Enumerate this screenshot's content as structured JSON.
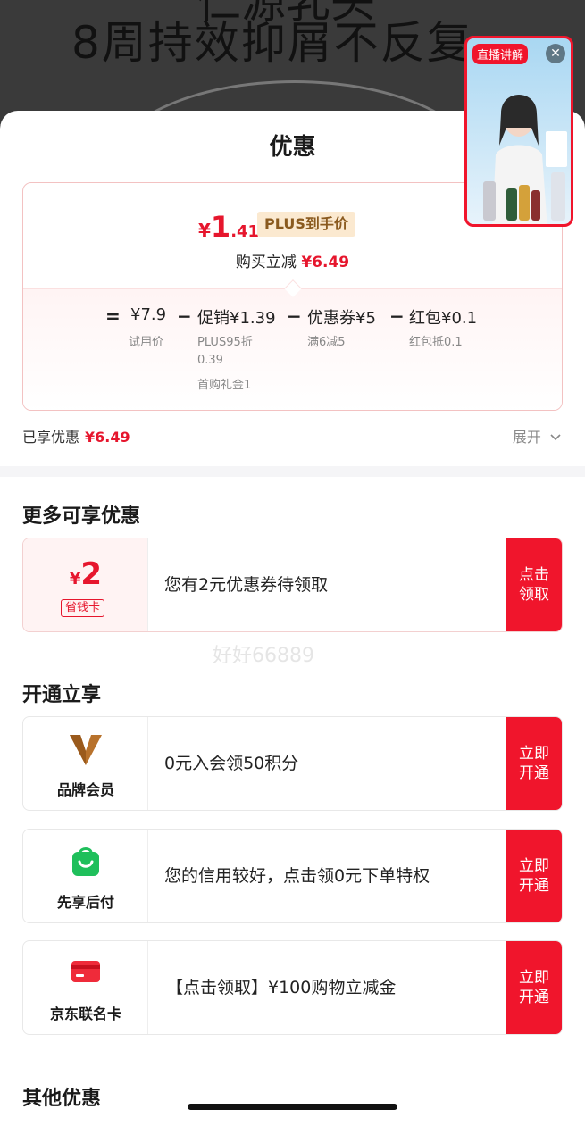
{
  "background": {
    "title_line1": "仁源乳头",
    "title_line2": "8周持效抑屑不反复"
  },
  "live": {
    "tag": "直播讲解",
    "close_label": "✕"
  },
  "sheet": {
    "title": "优惠",
    "summary": {
      "currency": "¥",
      "price_int": "1",
      "price_dec": ".41",
      "plus_tag": "PLUS到手价",
      "reduce_label": "购买立减",
      "reduce_amount": "¥6.49",
      "formula": {
        "eq": "=",
        "items": [
          {
            "main": "¥7.9",
            "sub": [
              "试用价"
            ]
          },
          {
            "main": "促销¥1.39",
            "sub": [
              "PLUS95折",
              "0.39",
              "首购礼金1"
            ]
          },
          {
            "main": "优惠券¥5",
            "sub": [
              "满6减5"
            ]
          },
          {
            "main": "红包¥0.1",
            "sub": [
              "红包抵0.1"
            ]
          }
        ],
        "op": "−"
      }
    },
    "enjoyed_label": "已享优惠",
    "enjoyed_amount": "¥6.49",
    "expand_label": "展开",
    "more_section": {
      "title": "更多可享优惠",
      "coupon": {
        "currency": "¥",
        "amount": "2",
        "tag": "省钱卡",
        "text": "您有2元优惠券待领取",
        "btn_line1": "点击",
        "btn_line2": "领取"
      }
    },
    "open_section": {
      "title": "开通立享",
      "items": [
        {
          "label": "品牌会员",
          "text": "0元入会领50积分",
          "btn_line1": "立即",
          "btn_line2": "开通"
        },
        {
          "label": "先享后付",
          "text": "您的信用较好，点击领0元下单特权",
          "btn_line1": "立即",
          "btn_line2": "开通"
        },
        {
          "label": "京东联名卡",
          "text": "【点击领取】¥100购物立减金",
          "btn_line1": "立即",
          "btn_line2": "开通"
        }
      ]
    },
    "other_section": {
      "title": "其他优惠"
    },
    "watermark": "好好66889"
  },
  "colors": {
    "accent_red": "#e6162d",
    "button_red": "#f0152c",
    "plus_gold": "#8a5a1f"
  }
}
